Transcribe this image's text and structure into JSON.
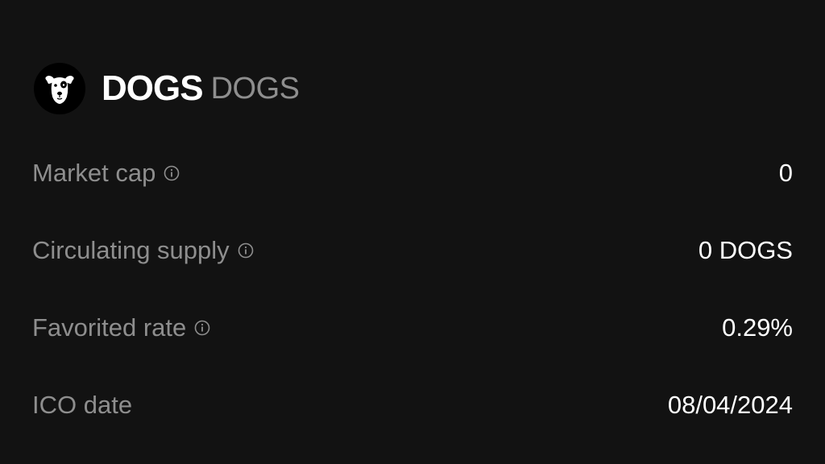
{
  "token": {
    "name": "DOGS",
    "symbol": "DOGS",
    "logo_icon": "dog-face-icon"
  },
  "stats": {
    "market_cap": {
      "label": "Market cap",
      "value": "0",
      "info_icon": "info-icon"
    },
    "circulating_supply": {
      "label": "Circulating supply",
      "value": "0 DOGS",
      "info_icon": "info-icon"
    },
    "favorited_rate": {
      "label": "Favorited rate",
      "value": "0.29%",
      "info_icon": "info-icon"
    },
    "ico_date": {
      "label": "ICO date",
      "value": "08/04/2024"
    }
  },
  "colors": {
    "background": "#121212",
    "primary_text": "#ffffff",
    "secondary_text": "#8e8e8e"
  }
}
